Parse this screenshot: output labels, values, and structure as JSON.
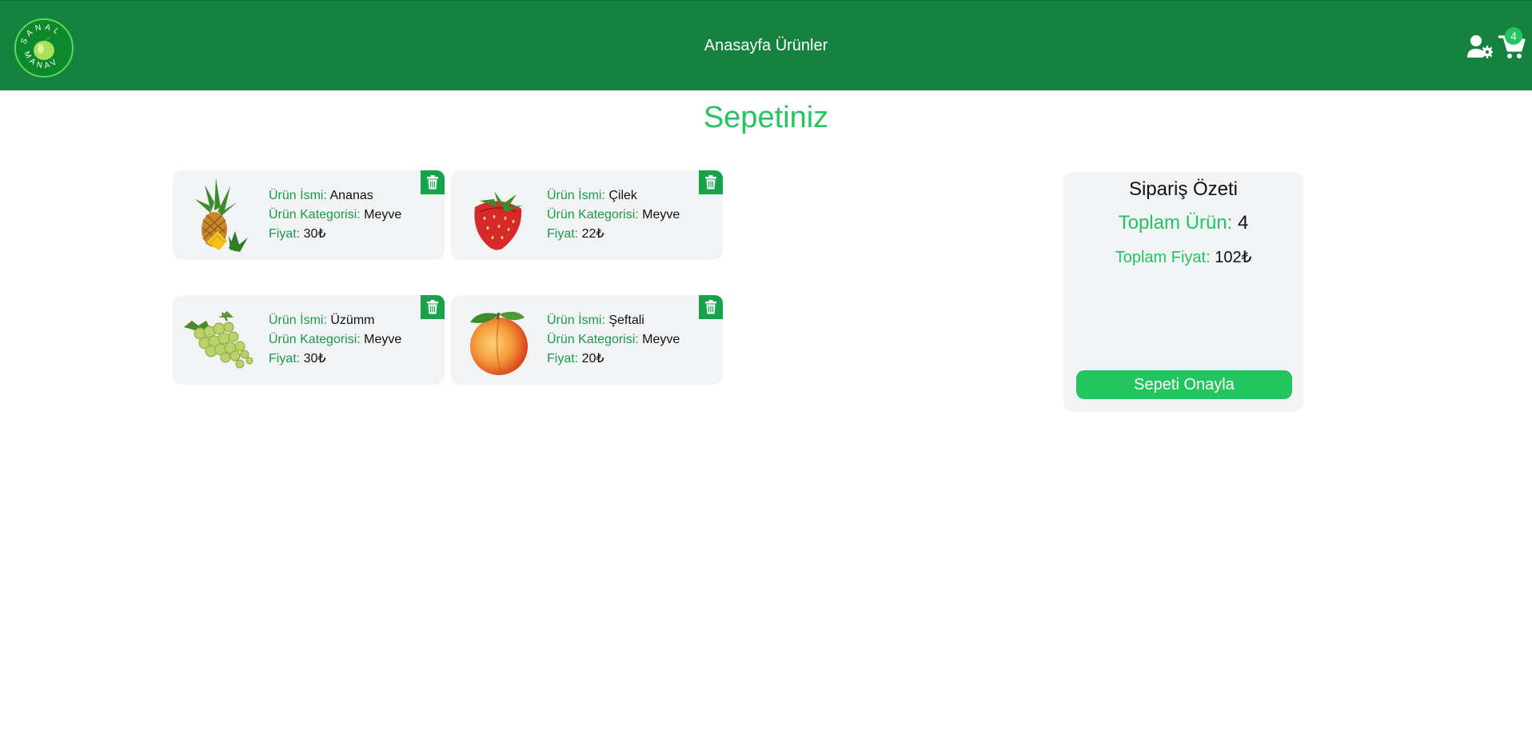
{
  "header": {
    "logo_text": "SANAL MANAV",
    "nav": [
      "Anasayfa",
      "Ürünler"
    ],
    "cart_count": "4",
    "user_icon": "user-gear-icon",
    "cart_icon": "shopping-cart-icon",
    "brand_color": "#16823f",
    "accent_color": "#22c55e"
  },
  "page": {
    "title": "Sepetiniz"
  },
  "labels": {
    "name": "Ürün İsmi:",
    "category": "Ürün Kategorisi:",
    "price": "Fiyat:"
  },
  "cart_items": [
    {
      "name": "Ananas",
      "category": "Meyve",
      "price": "30₺",
      "image": "pineapple"
    },
    {
      "name": "Çilek",
      "category": "Meyve",
      "price": "22₺",
      "image": "strawberry"
    },
    {
      "name": "Üzümm",
      "category": "Meyve",
      "price": "30₺",
      "image": "grapes"
    },
    {
      "name": "Şeftali",
      "category": "Meyve",
      "price": "20₺",
      "image": "peach"
    }
  ],
  "summary": {
    "title": "Sipariş Özeti",
    "total_items_label": "Toplam Ürün:",
    "total_items": "4",
    "total_price_label": "Toplam Fiyat:",
    "total_price": "102₺",
    "confirm_label": "Sepeti Onayla"
  }
}
